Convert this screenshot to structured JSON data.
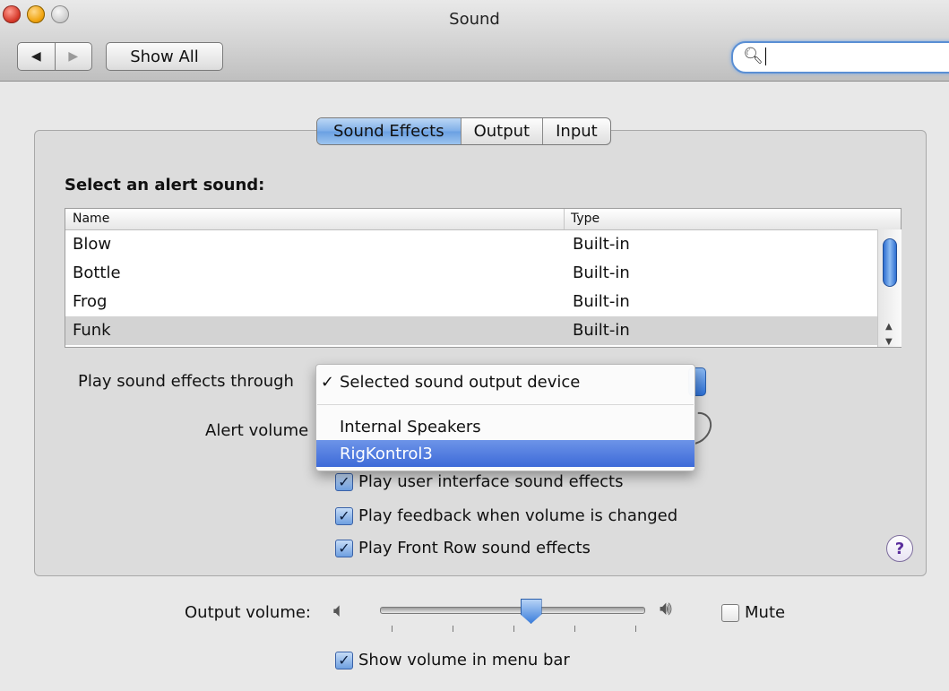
{
  "window": {
    "title": "Sound"
  },
  "toolbar": {
    "back_label": "◀",
    "forward_label": "▶",
    "show_all_label": "Show All",
    "search_value": ""
  },
  "tabs": [
    {
      "label": "Sound Effects",
      "active": true
    },
    {
      "label": "Output",
      "active": false
    },
    {
      "label": "Input",
      "active": false
    }
  ],
  "alert_section": {
    "title": "Select an alert sound:",
    "columns": [
      "Name",
      "Type"
    ],
    "rows": [
      {
        "name": "Blow",
        "type": "Built-in"
      },
      {
        "name": "Bottle",
        "type": "Built-in"
      },
      {
        "name": "Frog",
        "type": "Built-in"
      },
      {
        "name": "Funk",
        "type": "Built-in",
        "selected": true
      }
    ]
  },
  "form": {
    "play_through_label": "Play sound effects through",
    "alert_volume_label": "Alert volume"
  },
  "popup_menu": {
    "items": [
      {
        "label": "Selected sound output device",
        "checked": true
      },
      {
        "label": "Internal Speakers",
        "checked": false
      },
      {
        "label": "RigKontrol3",
        "checked": false,
        "highlighted": true
      }
    ],
    "check_glyph": "✓"
  },
  "checkboxes": {
    "ui_sounds": {
      "label": "Play user interface sound effects",
      "checked": true
    },
    "feedback": {
      "label": "Play feedback when volume is changed",
      "checked": true
    },
    "front_row": {
      "label": "Play Front Row sound effects",
      "checked": true
    }
  },
  "output": {
    "label": "Output volume:",
    "volume": 0.57,
    "mute_label": "Mute",
    "mute_checked": false,
    "show_in_menu_bar_label": "Show volume in menu bar",
    "show_in_menu_bar_checked": true
  },
  "help_label": "?",
  "colors": {
    "accent": "#3d6ad8",
    "selection_row": "#d3d3d3"
  }
}
